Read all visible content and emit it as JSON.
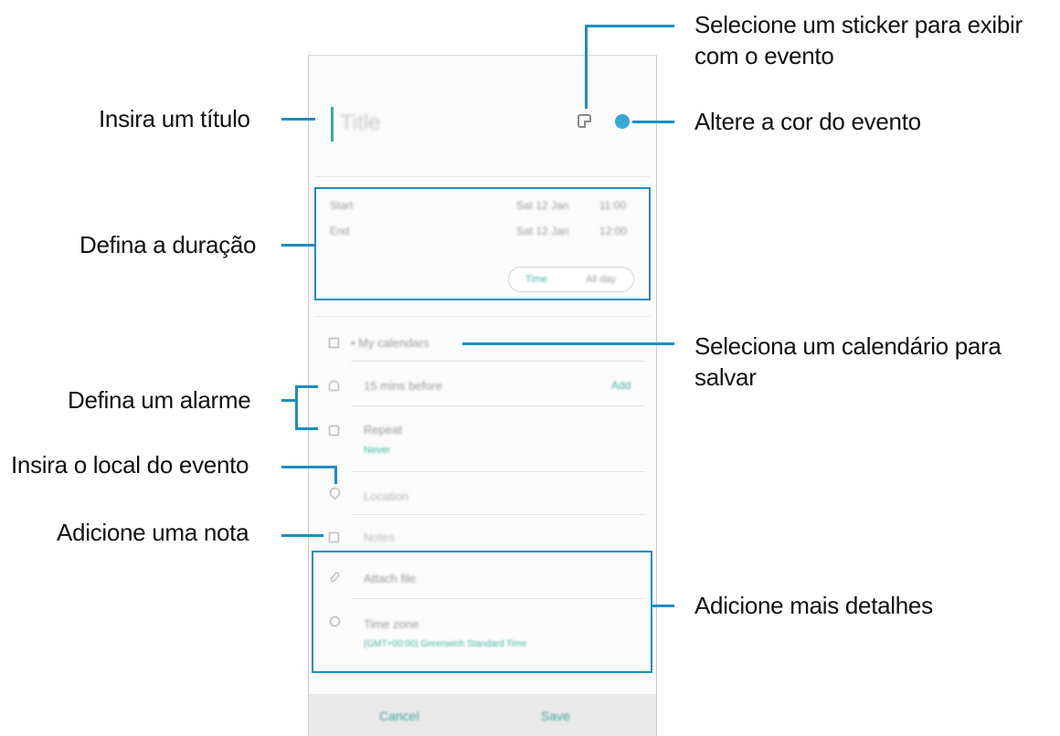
{
  "form": {
    "title_placeholder": "Title",
    "accent_color": "#3fa89b",
    "event_color": "#3aa6d8",
    "start_label": "Start",
    "start_date": "Sat 12 Jan",
    "start_time": "11:00",
    "end_label": "End",
    "end_date": "Sat 12 Jan",
    "end_time": "12:00",
    "time_option": "Time",
    "allday_option": "All day",
    "calendar": "My calendars",
    "alarm": "15 mins before",
    "alarm_add": "Add",
    "repeat_label": "Repeat",
    "repeat_value": "Never",
    "location_placeholder": "Location",
    "notes_placeholder": "Notes",
    "attach": "Attach file",
    "timezone_label": "Time zone",
    "timezone_value": "(GMT+00:00) Greenwich Standard Time",
    "cancel": "Cancel",
    "save": "Save"
  },
  "callouts": {
    "title": "Insira um título",
    "sticker_line1": "Selecione um sticker para exibir",
    "sticker_line2": "com o evento",
    "color": "Altere a cor do evento",
    "duration": "Defina a duração",
    "calendar_line1": "Seleciona um calendário para",
    "calendar_line2": "salvar",
    "alarm": "Defina um alarme",
    "location": "Insira o local do evento",
    "note": "Adicione uma nota",
    "details": "Adicione mais detalhes"
  },
  "icons": [
    "sticker-icon",
    "calendar-icon",
    "bell-icon",
    "repeat-icon",
    "location-pin-icon",
    "notes-icon",
    "paperclip-icon",
    "globe-icon"
  ],
  "callout_color": "#1d8dc1"
}
